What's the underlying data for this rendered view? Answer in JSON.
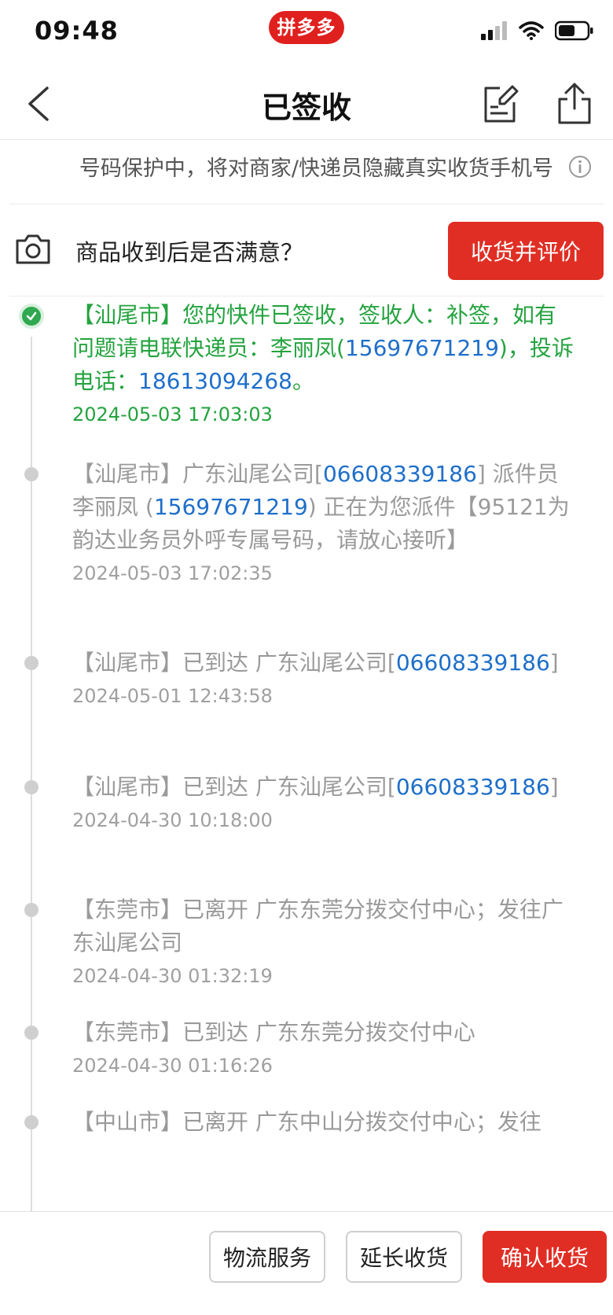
{
  "status_bar": {
    "time": "09:48",
    "app_badge": "拼多多"
  },
  "nav": {
    "title": "已签收"
  },
  "privacy": {
    "text": "号码保护中，将对商家/快递员隐藏真实收货手机号"
  },
  "rate": {
    "question": "商品收到后是否满意？",
    "button": "收货并评价"
  },
  "timeline": [
    {
      "parts": [
        {
          "t": "【汕尾市】您的快件已签收，签收人：补签，如有问题请电联快递员：李丽凤("
        },
        {
          "t": "15697671219",
          "num": true
        },
        {
          "t": ")，投诉电话："
        },
        {
          "t": "18613094268",
          "num": true
        },
        {
          "t": "。"
        }
      ],
      "time": "2024-05-03 17:03:03",
      "active": true
    },
    {
      "parts": [
        {
          "t": "【汕尾市】广东汕尾公司["
        },
        {
          "t": "06608339186",
          "num": true
        },
        {
          "t": "] 派件员 李丽凤 ("
        },
        {
          "t": "15697671219",
          "num": true
        },
        {
          "t": ") 正在为您派件【95121为韵达业务员外呼专属号码，请放心接听】"
        }
      ],
      "time": "2024-05-03 17:02:35"
    },
    {
      "parts": [
        {
          "t": "【汕尾市】已到达 广东汕尾公司["
        },
        {
          "t": "06608339186",
          "num": true
        },
        {
          "t": "]"
        }
      ],
      "time": "2024-05-01 12:43:58"
    },
    {
      "parts": [
        {
          "t": "【汕尾市】已到达 广东汕尾公司["
        },
        {
          "t": "06608339186",
          "num": true
        },
        {
          "t": "]"
        }
      ],
      "time": "2024-04-30 10:18:00"
    },
    {
      "parts": [
        {
          "t": "【东莞市】已离开 广东东莞分拨交付中心；发往广东汕尾公司"
        }
      ],
      "time": "2024-04-30 01:32:19"
    },
    {
      "parts": [
        {
          "t": "【东莞市】已到达 广东东莞分拨交付中心"
        }
      ],
      "time": "2024-04-30 01:16:26"
    },
    {
      "parts": [
        {
          "t": "【中山市】已离开 广东中山分拨交付中心；发往"
        }
      ],
      "time": ""
    }
  ],
  "bottom": {
    "logistics": "物流服务",
    "extend": "延长收货",
    "confirm": "确认收货"
  },
  "colors": {
    "accent_red": "#e02e24",
    "delivered_green": "#24a33f",
    "link_blue": "#1f6fc9"
  }
}
